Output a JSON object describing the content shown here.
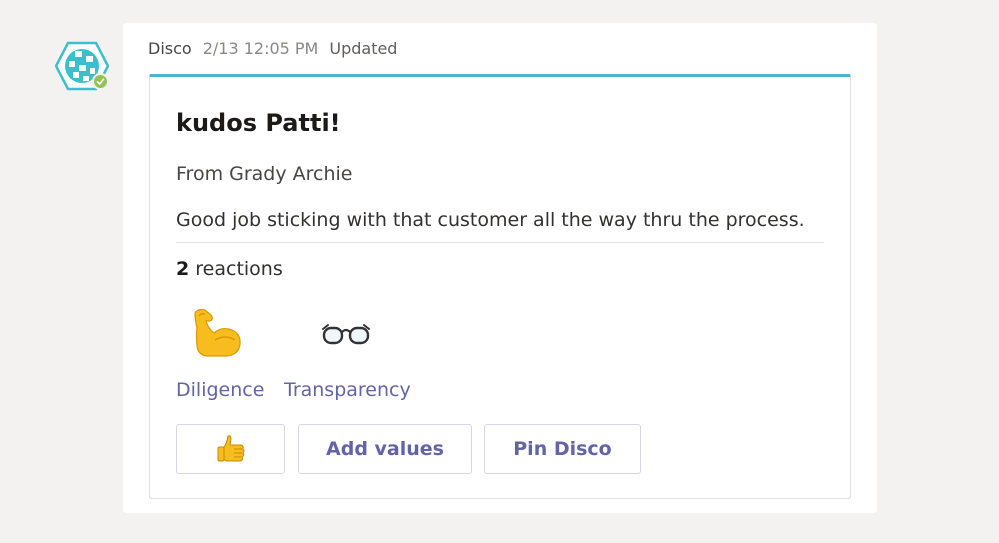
{
  "message": {
    "sender": "Disco",
    "timestamp": "2/13 12:05 PM",
    "edited_label": "Updated"
  },
  "card": {
    "title": "kudos Patti!",
    "from": "From Grady Archie",
    "text": "Good job sticking with that customer all the way thru the process.",
    "reactions": {
      "count": "2",
      "label": "reactions"
    },
    "values": [
      {
        "label": "Diligence",
        "icon": "flexed-biceps-icon"
      },
      {
        "label": "Transparency",
        "icon": "eyeglasses-icon"
      }
    ],
    "buttons": {
      "like_icon": "thumbs-up-icon",
      "add_values": "Add values",
      "pin": "Pin Disco"
    }
  },
  "colors": {
    "accent": "#6264a7",
    "card_top_border": "#4fb3cf",
    "presence": "#92c353"
  }
}
